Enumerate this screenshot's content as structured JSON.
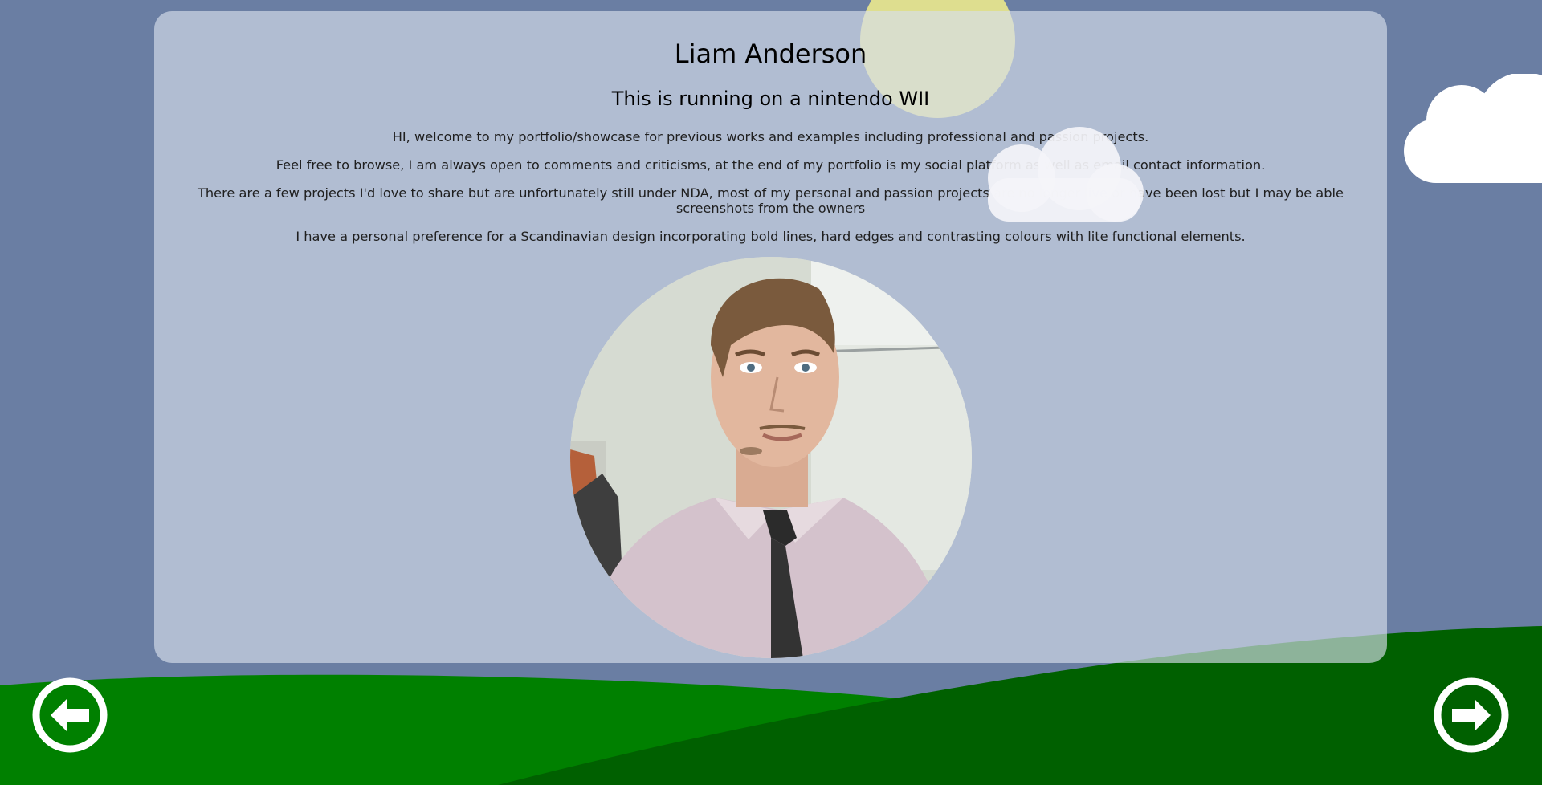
{
  "profile": {
    "name": "Liam Anderson",
    "subtitle": "This is running on a nintendo WII",
    "paragraphs": [
      "HI, welcome to my portfolio/showcase for previous works and examples including professional and passion projects.",
      "Feel free to browse, I am always open to comments and criticisms, at the end of my portfolio is my social platform as well as email contact information.",
      "There are a few projects I'd love to share but are unfortunately still under NDA, most of my personal and passion projects are no longer live or have been lost but I may be able screenshots from the owners",
      "I have a personal preference for a Scandinavian design incorporating bold lines, hard edges and contrasting colours with lite functional elements."
    ]
  },
  "navigation": {
    "prev_icon": "arrow-left-circle-icon",
    "next_icon": "arrow-right-circle-icon"
  },
  "colors": {
    "sky": "#6a7ea3",
    "card": "#d6ddea",
    "sun": "#dede8f",
    "hill_light": "#008000",
    "hill_dark": "#006000",
    "button": "#ffffff"
  }
}
